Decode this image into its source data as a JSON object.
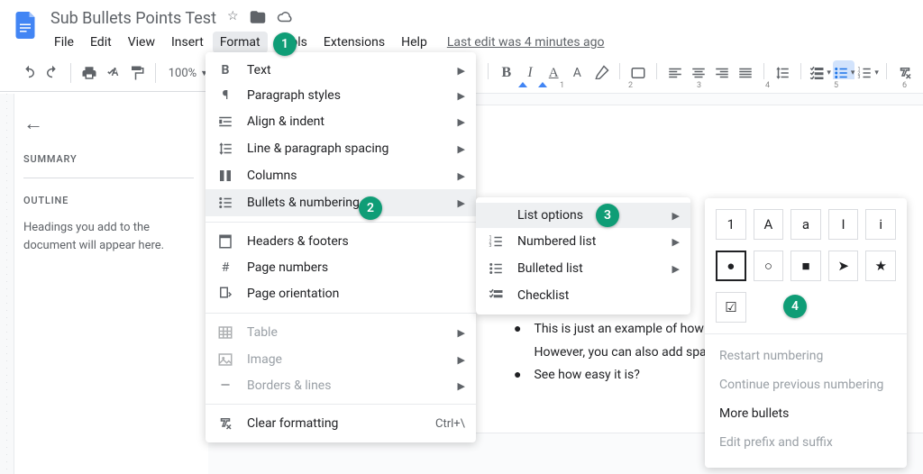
{
  "doc": {
    "title": "Sub Bullets Points Test",
    "last_edit": "Last edit was 4 minutes ago"
  },
  "menus": {
    "file": "File",
    "edit": "Edit",
    "view": "View",
    "insert": "Insert",
    "format": "Format",
    "tools": "Tools",
    "extensions": "Extensions",
    "help": "Help"
  },
  "toolbar": {
    "zoom": "100%"
  },
  "ruler": {
    "t1": "1",
    "t2": "2",
    "t3": "3",
    "t4": "4",
    "t5": "5",
    "t6": "6"
  },
  "outline": {
    "summary": "SUMMARY",
    "outline": "OUTLINE",
    "note": "Headings you add to the document will appear here."
  },
  "format_menu": {
    "text": "Text",
    "paragraph": "Paragraph styles",
    "align": "Align & indent",
    "spacing": "Line & paragraph spacing",
    "columns": "Columns",
    "bullets": "Bullets & numbering",
    "headers": "Headers & footers",
    "pagenums": "Page numbers",
    "orientation": "Page orientation",
    "table": "Table",
    "image": "Image",
    "borders": "Borders & lines",
    "clear": "Clear formatting",
    "clear_shortcut": "Ctrl+\\"
  },
  "bullets_submenu": {
    "list_options": "List options",
    "numbered": "Numbered list",
    "bulleted": "Bulleted list",
    "checklist": "Checklist"
  },
  "list_options": {
    "g1": [
      "1",
      "A",
      "a",
      "I",
      "i"
    ],
    "g2": [
      "●",
      "○",
      "■",
      "➤",
      "★"
    ],
    "g3": [
      "☑"
    ],
    "restart": "Restart numbering",
    "cont": "Continue previous numbering",
    "more": "More bullets",
    "prefix": "Edit prefix and suffix"
  },
  "doc_content": {
    "l1": "This is just an example of how multiple lines, so long as you d",
    "l2": "However, you can also add spa",
    "l3": "See how easy it is?"
  },
  "badges": {
    "b1": "1",
    "b2": "2",
    "b3": "3",
    "b4": "4"
  }
}
